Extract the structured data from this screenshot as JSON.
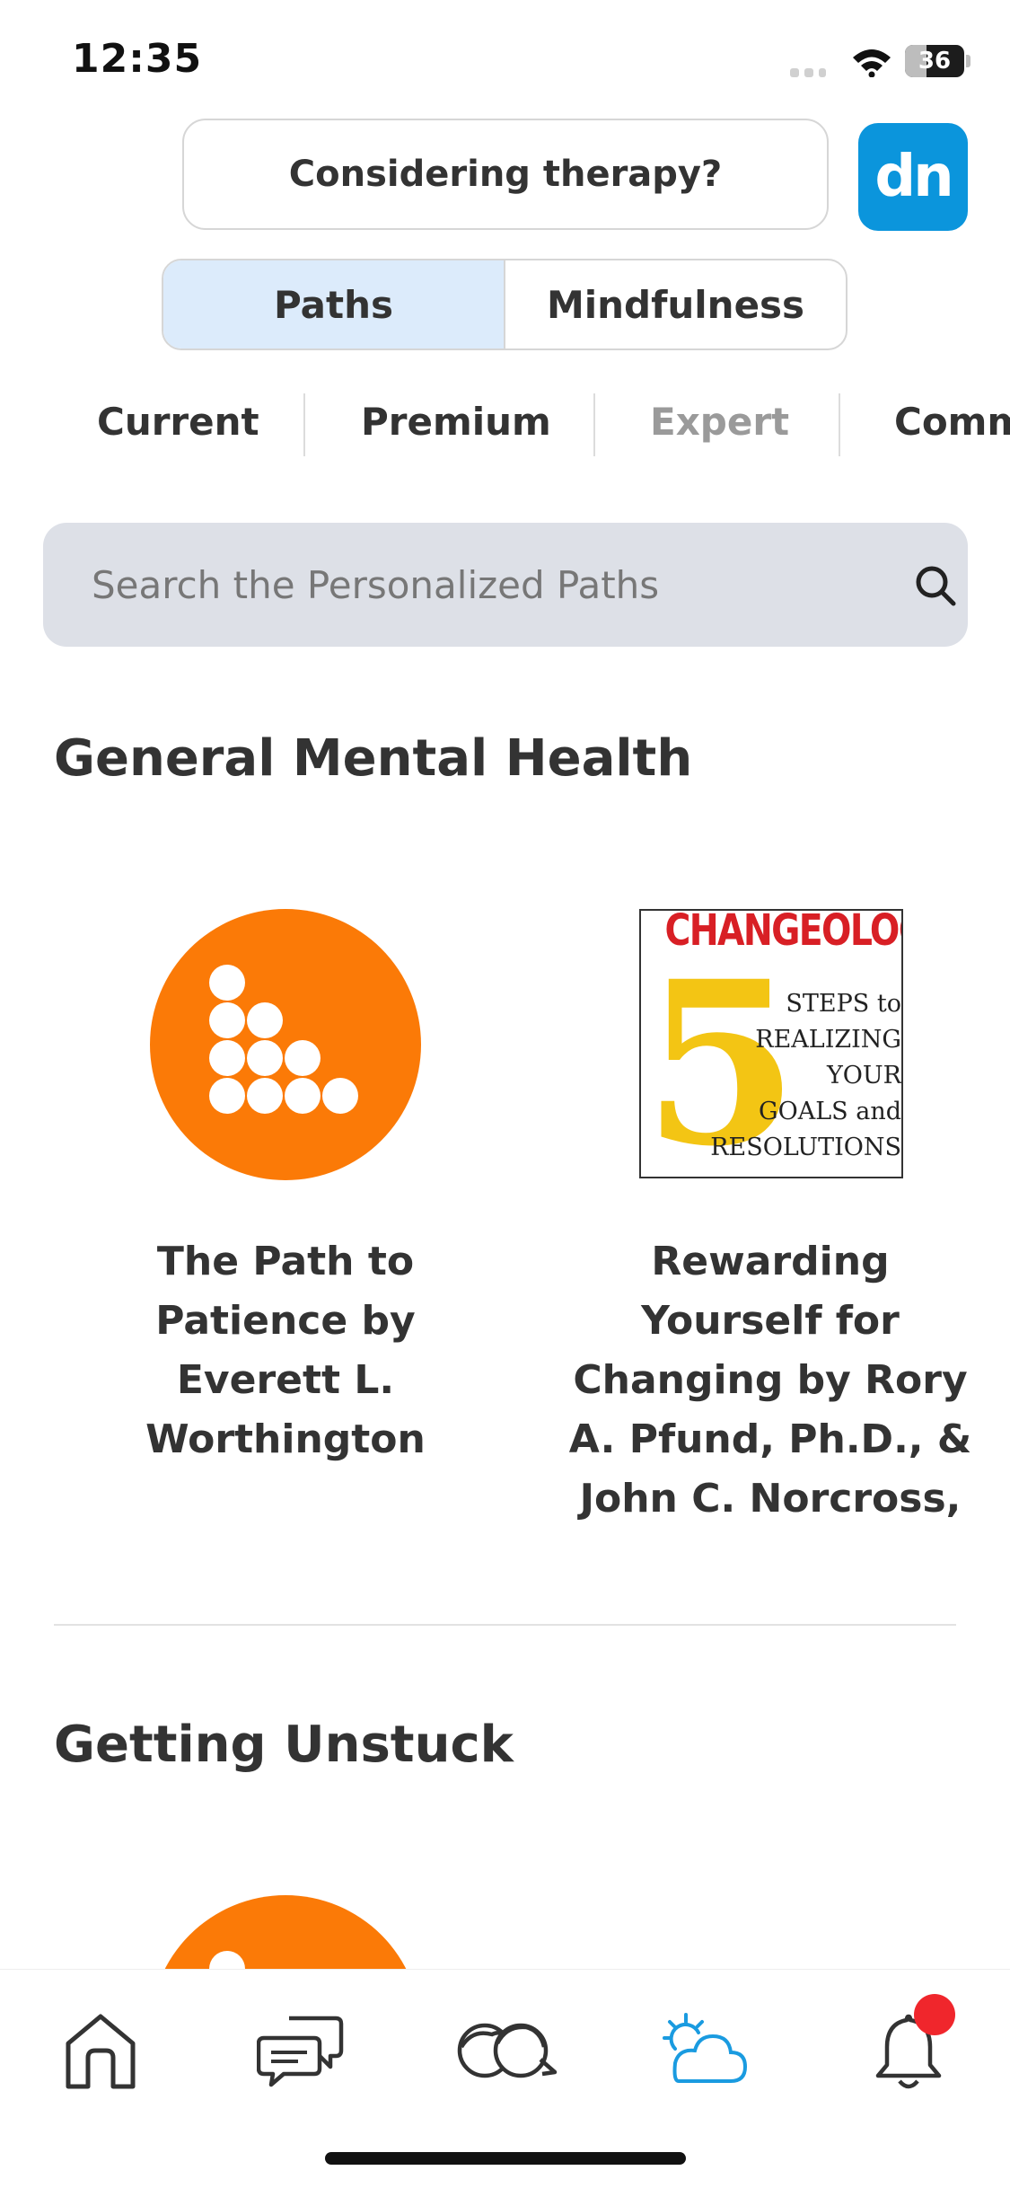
{
  "status": {
    "time": "12:35",
    "battery": "36",
    "battery_level": 0.36
  },
  "header": {
    "therapy_label": "Considering therapy?",
    "avatar_initials": "dn"
  },
  "segments": [
    {
      "label": "Paths",
      "active": true
    },
    {
      "label": "Mindfulness",
      "active": false
    }
  ],
  "categories": [
    {
      "label": "Current"
    },
    {
      "label": "Premium"
    },
    {
      "label": "Expert"
    },
    {
      "label": "Comm"
    }
  ],
  "search": {
    "placeholder": "Search the Personalized Paths"
  },
  "sections": [
    {
      "title": "General Mental Health",
      "cards": [
        {
          "title_lines": [
            "The Path to",
            "Patience by",
            "Everett L.",
            "Worthington"
          ]
        },
        {
          "title_lines": [
            "Rewarding",
            "Yourself for",
            "Changing by Rory",
            "A. Pfund, Ph.D., &",
            "John C. Norcross,"
          ],
          "cover": {
            "title": "CHANGEOLOGY",
            "number": "5",
            "lines": [
              "STEPS to",
              "REALIZING",
              "YOUR",
              "GOALS and",
              "RESOLUTIONS"
            ]
          }
        }
      ]
    },
    {
      "title": "Getting Unstuck",
      "cards": []
    }
  ],
  "tabbar": {
    "items": [
      "home-icon",
      "chat-icon",
      "community-icon",
      "weather-icon",
      "bell-icon"
    ],
    "active_color": "#1a9be0",
    "inactive_color": "#333333",
    "notification_badge_color": "#f0262c"
  },
  "colors": {
    "brand_orange": "#fb7a07",
    "brand_blue": "#0b95dc",
    "segment_active": "#dcebfb",
    "search_bg": "#dde0e7"
  }
}
